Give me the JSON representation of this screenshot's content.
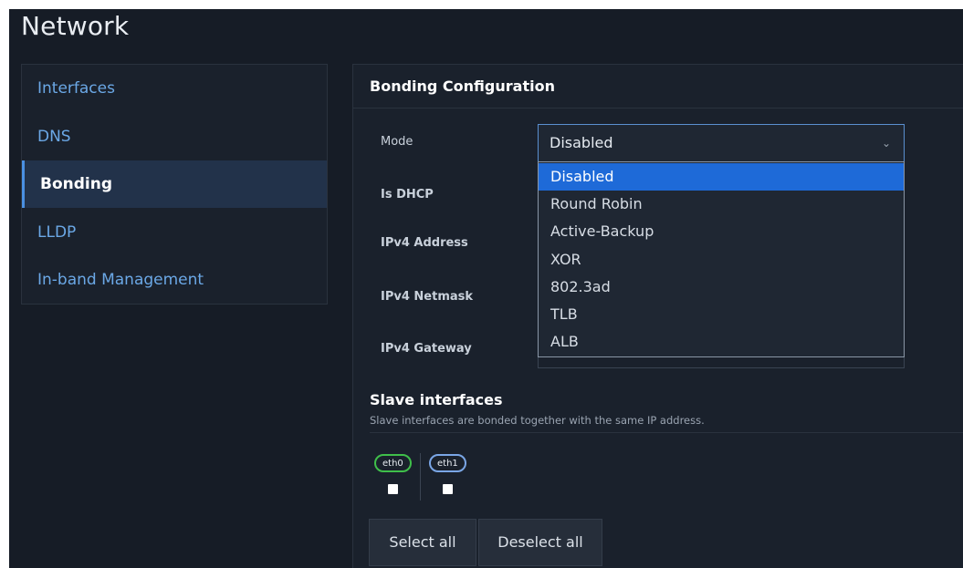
{
  "page": {
    "title": "Network"
  },
  "sidebar": {
    "items": [
      {
        "label": "Interfaces",
        "active": false
      },
      {
        "label": "DNS",
        "active": false
      },
      {
        "label": "Bonding",
        "active": true
      },
      {
        "label": "LLDP",
        "active": false
      },
      {
        "label": "In-band Management",
        "active": false
      }
    ]
  },
  "bonding": {
    "header": "Bonding Configuration",
    "labels": {
      "mode": "Mode",
      "is_dhcp": "Is DHCP",
      "ipv4_address": "IPv4 Address",
      "ipv4_netmask": "IPv4 Netmask",
      "ipv4_gateway": "IPv4 Gateway"
    },
    "mode_select": {
      "value": "Disabled",
      "options": [
        "Disabled",
        "Round Robin",
        "Active-Backup",
        "XOR",
        "802.3ad",
        "TLB",
        "ALB"
      ],
      "highlighted": "Disabled"
    }
  },
  "slave": {
    "title": "Slave interfaces",
    "description": "Slave interfaces are bonded together with the same IP address.",
    "interfaces": [
      {
        "name": "eth0",
        "color": "#3fbf4a",
        "checked": false
      },
      {
        "name": "eth1",
        "color": "#7aa6e6",
        "checked": false
      }
    ],
    "select_all_label": "Select all",
    "deselect_all_label": "Deselect all"
  },
  "colors": {
    "accent": "#1e6ad8",
    "link": "#6ba8e6",
    "background": "#161c26"
  },
  "icons": {
    "select_chevron": "chevron-down-icon"
  }
}
